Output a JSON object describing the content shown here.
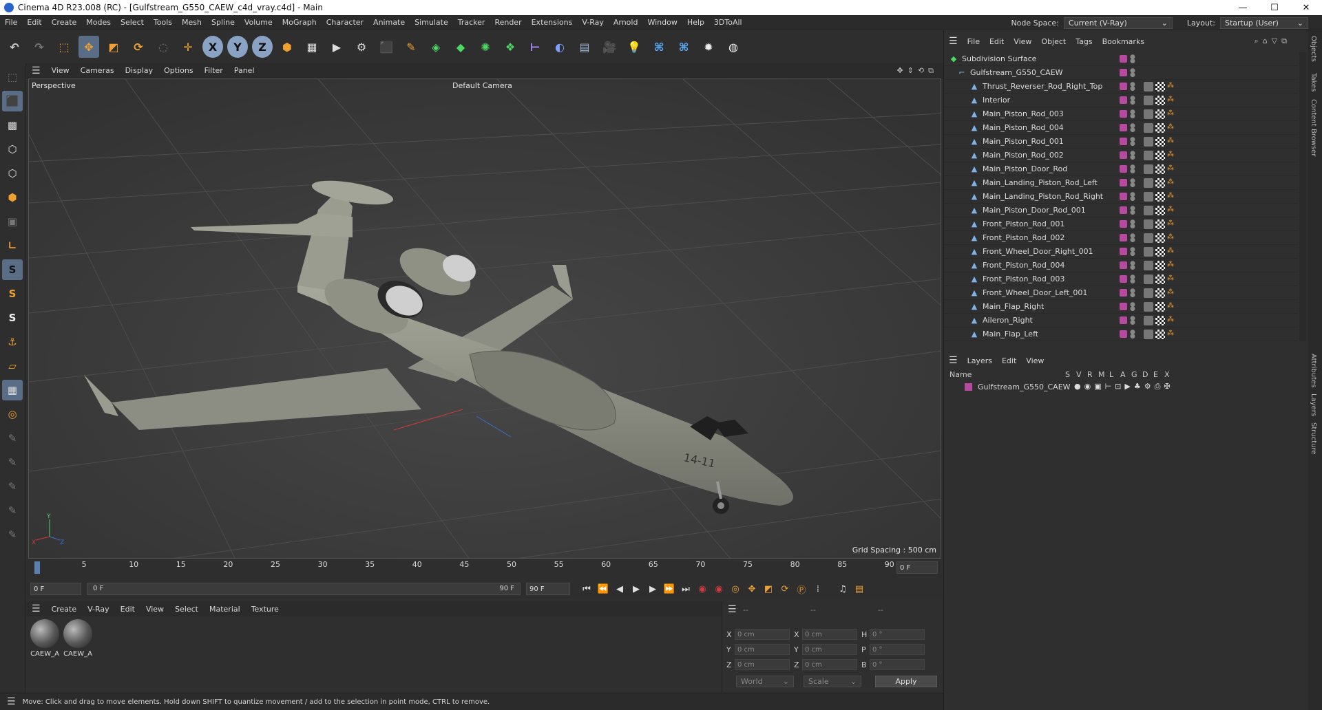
{
  "window": {
    "title": "Cinema 4D R23.008 (RC) - [Gulfstream_G550_CAEW_c4d_vray.c4d] - Main",
    "minimize": "—",
    "maximize": "☐",
    "close": "✕"
  },
  "menubar": {
    "items": [
      "File",
      "Edit",
      "Create",
      "Modes",
      "Select",
      "Tools",
      "Mesh",
      "Spline",
      "Volume",
      "MoGraph",
      "Character",
      "Animate",
      "Simulate",
      "Tracker",
      "Render",
      "Extensions",
      "V-Ray",
      "Arnold",
      "Window",
      "Help",
      "3DToAll"
    ],
    "node_space_label": "Node Space:",
    "node_space_value": "Current (V-Ray)",
    "layout_label": "Layout:",
    "layout_value": "Startup (User)"
  },
  "viewport": {
    "menu": [
      "View",
      "Cameras",
      "Display",
      "Options",
      "Filter",
      "Panel"
    ],
    "label": "Perspective",
    "camera": "Default Camera",
    "grid_spacing": "Grid Spacing : 500 cm",
    "aircraft_tail_text": "14-11"
  },
  "timeline": {
    "ticks": [
      "0",
      "5",
      "10",
      "15",
      "20",
      "25",
      "30",
      "35",
      "40",
      "45",
      "50",
      "55",
      "60",
      "65",
      "70",
      "75",
      "80",
      "85",
      "90"
    ],
    "current_frame": "0 F",
    "start_frame": "0 F",
    "range_start": "0 F",
    "range_end": "90 F",
    "end_frame": "90 F"
  },
  "materials": {
    "menu": [
      "Create",
      "V-Ray",
      "Edit",
      "View",
      "Select",
      "Material",
      "Texture"
    ],
    "items": [
      "CAEW_A",
      "CAEW_A"
    ]
  },
  "coords": {
    "headers": [
      "--",
      "--",
      "--"
    ],
    "rows": [
      {
        "a": "X",
        "av": "0 cm",
        "b": "X",
        "bv": "0 cm",
        "c": "H",
        "cv": "0 °"
      },
      {
        "a": "Y",
        "av": "0 cm",
        "b": "Y",
        "bv": "0 cm",
        "c": "P",
        "cv": "0 °"
      },
      {
        "a": "Z",
        "av": "0 cm",
        "b": "Z",
        "bv": "0 cm",
        "c": "B",
        "cv": "0 °"
      }
    ],
    "world": "World",
    "scale": "Scale",
    "apply": "Apply"
  },
  "status": "Move: Click and drag to move elements. Hold down SHIFT to quantize movement / add to the selection in point mode, CTRL to remove.",
  "objects": {
    "menu": [
      "File",
      "Edit",
      "View",
      "Object",
      "Tags",
      "Bookmarks"
    ],
    "root": "Subdivision Surface",
    "group": "Gulfstream_G550_CAEW",
    "children": [
      "Thrust_Reverser_Rod_Right_Top",
      "Interior",
      "Main_Piston_Rod_003",
      "Main_Piston_Rod_004",
      "Main_Piston_Rod_001",
      "Main_Piston_Rod_002",
      "Main_Piston_Door_Rod",
      "Main_Landing_Piston_Rod_Left",
      "Main_Landing_Piston_Rod_Right",
      "Main_Piston_Door_Rod_001",
      "Front_Piston_Rod_001",
      "Front_Piston_Rod_002",
      "Front_Wheel_Door_Right_001",
      "Front_Piston_Rod_004",
      "Front_Piston_Rod_003",
      "Front_Wheel_Door_Left_001",
      "Main_Flap_Right",
      "Aileron_Right",
      "Main_Flap_Left"
    ]
  },
  "layers": {
    "menu": [
      "Layers",
      "Edit",
      "View"
    ],
    "name_col": "Name",
    "cols": [
      "S",
      "V",
      "R",
      "M",
      "L",
      "A",
      "G",
      "D",
      "E",
      "X"
    ],
    "row": "Gulfstream_G550_CAEW"
  },
  "side_tabs": [
    "Objects",
    "Takes",
    "Content Browser",
    "Attributes",
    "Layers",
    "Structure"
  ]
}
